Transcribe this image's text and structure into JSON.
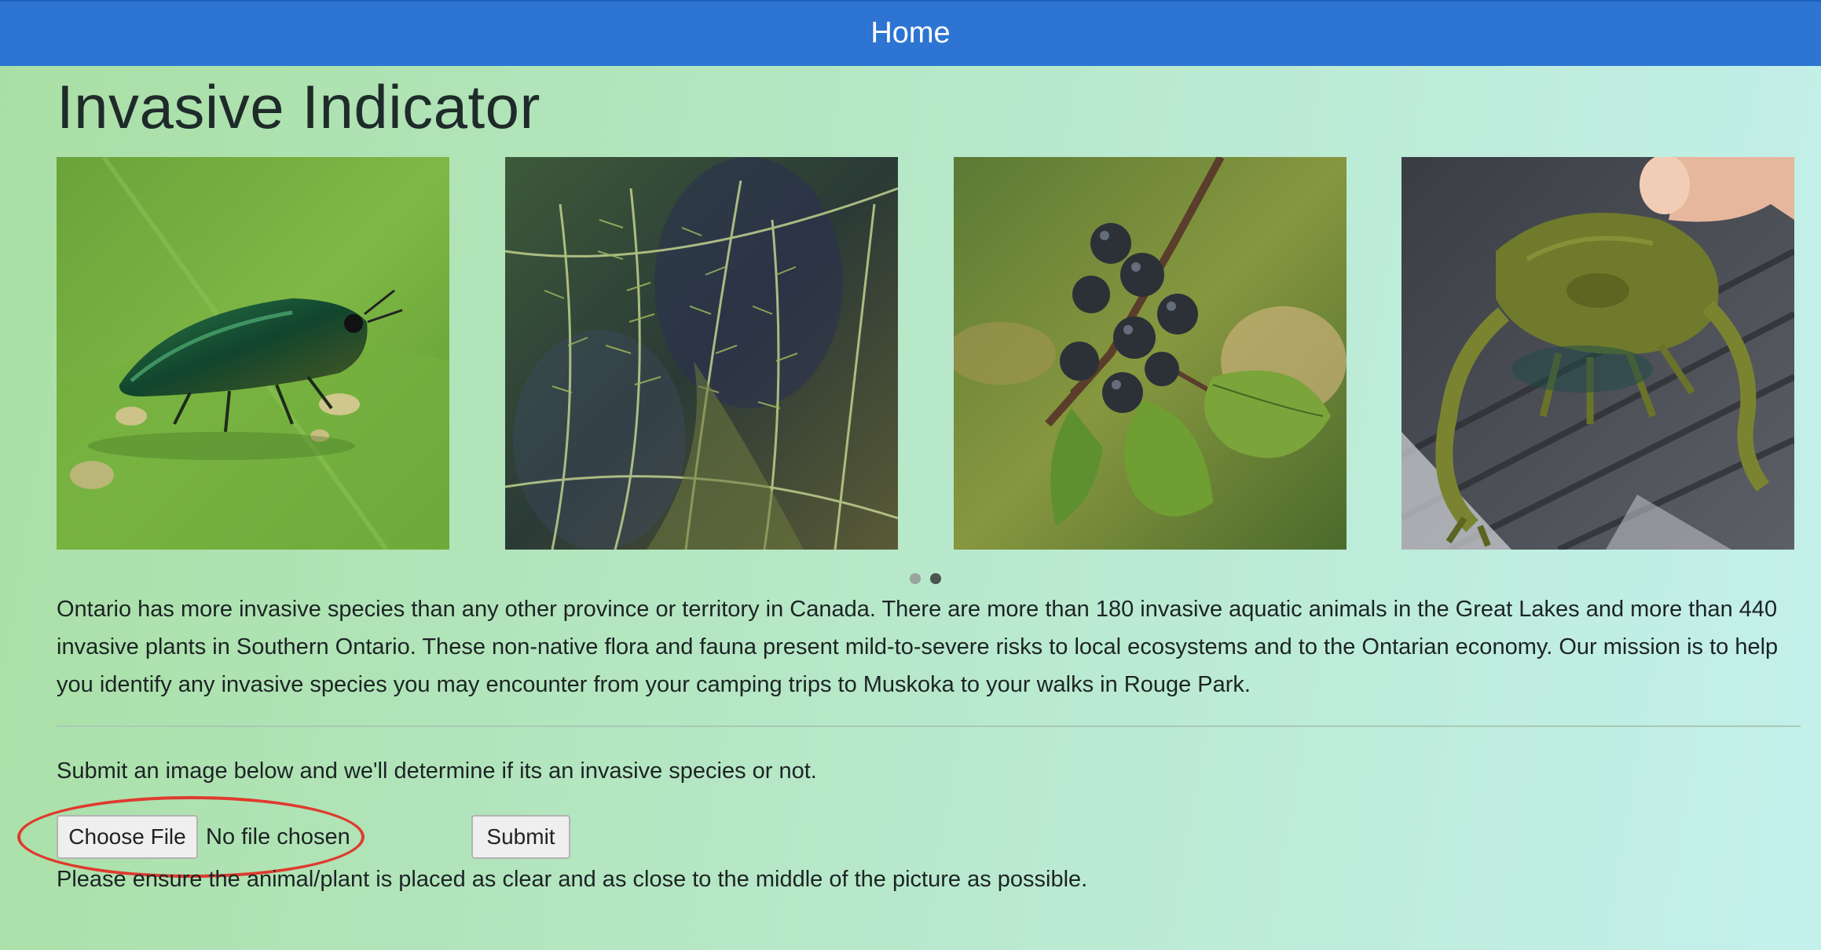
{
  "navbar": {
    "home_label": "Home",
    "background": "#2d74d3"
  },
  "page": {
    "title": "Invasive Indicator"
  },
  "carousel": {
    "slides": [
      {
        "subject": "emerald ash borer beetle on leaf",
        "icon": "beetle-image"
      },
      {
        "subject": "aquatic milfoil plant underwater",
        "icon": "milfoil-image"
      },
      {
        "subject": "buckthorn berries on branch",
        "icon": "buckthorn-image"
      },
      {
        "subject": "green crab held in hand",
        "icon": "crab-image"
      }
    ],
    "indicator_count": 2,
    "active_indicator": 1,
    "indicator_colors": {
      "inactive": "#9aa39e",
      "active": "#4b5450"
    }
  },
  "content": {
    "intro": "Ontario has more invasive species than any other province or territory in Canada. There are more than 180 invasive aquatic animals in the Great Lakes and more than 440 invasive plants in Southern Ontario. These non-native flora and fauna present mild-to-severe risks to local ecosystems and to the Ontarian economy. Our mission is to help you identify any invasive species you may encounter from your camping trips to Muskoka to your walks in Rouge Park.",
    "submit_prompt": "Submit an image below and we'll determine if its an invasive species or not.",
    "note": "Please ensure the animal/plant is placed as clear and as close to the middle of the picture as possible."
  },
  "form": {
    "choose_file_label": "Choose File",
    "file_status": "No file chosen",
    "submit_label": "Submit"
  },
  "annotation": {
    "highlight_color": "#e03a2e"
  }
}
